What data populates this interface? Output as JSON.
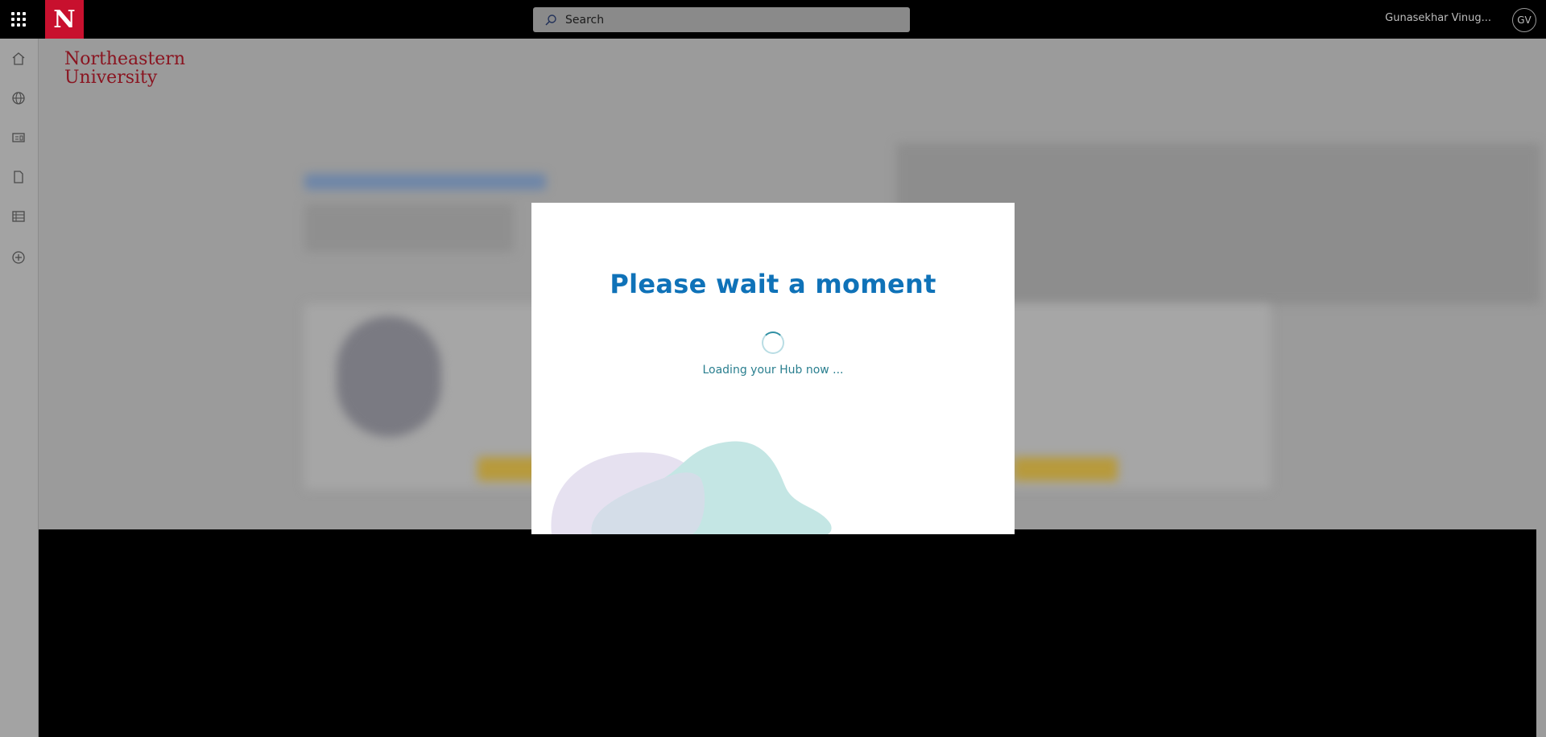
{
  "topbar": {
    "search_placeholder": "Search",
    "user_name": "Gunasekhar Vinug...",
    "avatar_initials": "GV",
    "logo_letter": "N"
  },
  "brand": {
    "line1": "Northeastern",
    "line2": "University"
  },
  "rail_icons": [
    "home-icon",
    "globe-icon",
    "id-card-icon",
    "document-icon",
    "list-icon",
    "add-circle-icon"
  ],
  "modal": {
    "title": "Please wait a moment",
    "loading_text": "Loading your Hub now ..."
  },
  "colors": {
    "brand_red": "#c8102e",
    "title_blue": "#0f72b8",
    "teal_text": "#2a7f8f",
    "blob_lavender": "#e6e1f0",
    "blob_teal": "#c4e6e4"
  }
}
